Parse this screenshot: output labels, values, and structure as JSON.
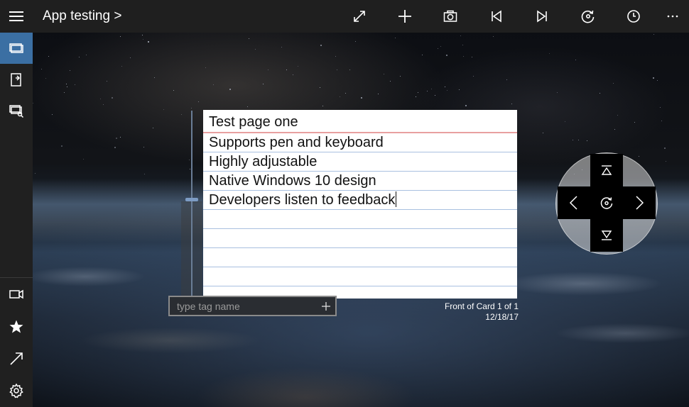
{
  "titlebar": {
    "menu_icon": "hamburger-icon",
    "app_title": "App testing >",
    "toolbar_icons": [
      "expand-icon",
      "plus-icon",
      "camera-icon",
      "skip-to-start-icon",
      "skip-to-end-icon",
      "reload-card-icon",
      "clock-icon",
      "more-icon"
    ]
  },
  "sidebar": {
    "top_items": [
      "cards-icon",
      "export-icon",
      "card-search-icon"
    ],
    "bottom_items": [
      "video-icon",
      "star-icon",
      "arrow-diagonal-icon",
      "settings-icon"
    ]
  },
  "card": {
    "title": "Test page one",
    "lines": [
      "Supports pen and keyboard",
      "Highly adjustable",
      "Native Windows 10 design",
      "Developers listen to feedback",
      "",
      "",
      "",
      ""
    ],
    "tag_placeholder": "type tag name",
    "meta_side": "Front of Card 1 of 1",
    "meta_date": "12/18/17"
  },
  "dpad": {
    "up_icon": "collapse-up-icon",
    "down_icon": "collapse-down-icon",
    "left_icon": "chevron-left-icon",
    "right_icon": "chevron-right-icon",
    "center_icon": "flip-card-icon"
  },
  "colors": {
    "titlebar_bg": "#1f1f1f",
    "sidebar_bg": "#202020",
    "sidebar_active": "#3b6fa3",
    "card_title_rule": "#e8a0a0",
    "card_line_rule": "#a9c0e0"
  }
}
